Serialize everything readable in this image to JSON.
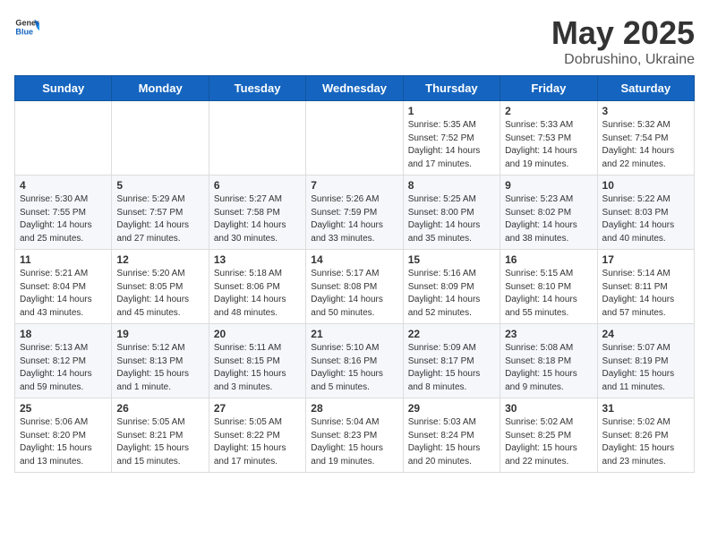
{
  "header": {
    "logo_general": "General",
    "logo_blue": "Blue",
    "month": "May 2025",
    "location": "Dobrushino, Ukraine"
  },
  "weekdays": [
    "Sunday",
    "Monday",
    "Tuesday",
    "Wednesday",
    "Thursday",
    "Friday",
    "Saturday"
  ],
  "weeks": [
    [
      {
        "day": "",
        "info": ""
      },
      {
        "day": "",
        "info": ""
      },
      {
        "day": "",
        "info": ""
      },
      {
        "day": "",
        "info": ""
      },
      {
        "day": "1",
        "info": "Sunrise: 5:35 AM\nSunset: 7:52 PM\nDaylight: 14 hours\nand 17 minutes."
      },
      {
        "day": "2",
        "info": "Sunrise: 5:33 AM\nSunset: 7:53 PM\nDaylight: 14 hours\nand 19 minutes."
      },
      {
        "day": "3",
        "info": "Sunrise: 5:32 AM\nSunset: 7:54 PM\nDaylight: 14 hours\nand 22 minutes."
      }
    ],
    [
      {
        "day": "4",
        "info": "Sunrise: 5:30 AM\nSunset: 7:55 PM\nDaylight: 14 hours\nand 25 minutes."
      },
      {
        "day": "5",
        "info": "Sunrise: 5:29 AM\nSunset: 7:57 PM\nDaylight: 14 hours\nand 27 minutes."
      },
      {
        "day": "6",
        "info": "Sunrise: 5:27 AM\nSunset: 7:58 PM\nDaylight: 14 hours\nand 30 minutes."
      },
      {
        "day": "7",
        "info": "Sunrise: 5:26 AM\nSunset: 7:59 PM\nDaylight: 14 hours\nand 33 minutes."
      },
      {
        "day": "8",
        "info": "Sunrise: 5:25 AM\nSunset: 8:00 PM\nDaylight: 14 hours\nand 35 minutes."
      },
      {
        "day": "9",
        "info": "Sunrise: 5:23 AM\nSunset: 8:02 PM\nDaylight: 14 hours\nand 38 minutes."
      },
      {
        "day": "10",
        "info": "Sunrise: 5:22 AM\nSunset: 8:03 PM\nDaylight: 14 hours\nand 40 minutes."
      }
    ],
    [
      {
        "day": "11",
        "info": "Sunrise: 5:21 AM\nSunset: 8:04 PM\nDaylight: 14 hours\nand 43 minutes."
      },
      {
        "day": "12",
        "info": "Sunrise: 5:20 AM\nSunset: 8:05 PM\nDaylight: 14 hours\nand 45 minutes."
      },
      {
        "day": "13",
        "info": "Sunrise: 5:18 AM\nSunset: 8:06 PM\nDaylight: 14 hours\nand 48 minutes."
      },
      {
        "day": "14",
        "info": "Sunrise: 5:17 AM\nSunset: 8:08 PM\nDaylight: 14 hours\nand 50 minutes."
      },
      {
        "day": "15",
        "info": "Sunrise: 5:16 AM\nSunset: 8:09 PM\nDaylight: 14 hours\nand 52 minutes."
      },
      {
        "day": "16",
        "info": "Sunrise: 5:15 AM\nSunset: 8:10 PM\nDaylight: 14 hours\nand 55 minutes."
      },
      {
        "day": "17",
        "info": "Sunrise: 5:14 AM\nSunset: 8:11 PM\nDaylight: 14 hours\nand 57 minutes."
      }
    ],
    [
      {
        "day": "18",
        "info": "Sunrise: 5:13 AM\nSunset: 8:12 PM\nDaylight: 14 hours\nand 59 minutes."
      },
      {
        "day": "19",
        "info": "Sunrise: 5:12 AM\nSunset: 8:13 PM\nDaylight: 15 hours\nand 1 minute."
      },
      {
        "day": "20",
        "info": "Sunrise: 5:11 AM\nSunset: 8:15 PM\nDaylight: 15 hours\nand 3 minutes."
      },
      {
        "day": "21",
        "info": "Sunrise: 5:10 AM\nSunset: 8:16 PM\nDaylight: 15 hours\nand 5 minutes."
      },
      {
        "day": "22",
        "info": "Sunrise: 5:09 AM\nSunset: 8:17 PM\nDaylight: 15 hours\nand 8 minutes."
      },
      {
        "day": "23",
        "info": "Sunrise: 5:08 AM\nSunset: 8:18 PM\nDaylight: 15 hours\nand 9 minutes."
      },
      {
        "day": "24",
        "info": "Sunrise: 5:07 AM\nSunset: 8:19 PM\nDaylight: 15 hours\nand 11 minutes."
      }
    ],
    [
      {
        "day": "25",
        "info": "Sunrise: 5:06 AM\nSunset: 8:20 PM\nDaylight: 15 hours\nand 13 minutes."
      },
      {
        "day": "26",
        "info": "Sunrise: 5:05 AM\nSunset: 8:21 PM\nDaylight: 15 hours\nand 15 minutes."
      },
      {
        "day": "27",
        "info": "Sunrise: 5:05 AM\nSunset: 8:22 PM\nDaylight: 15 hours\nand 17 minutes."
      },
      {
        "day": "28",
        "info": "Sunrise: 5:04 AM\nSunset: 8:23 PM\nDaylight: 15 hours\nand 19 minutes."
      },
      {
        "day": "29",
        "info": "Sunrise: 5:03 AM\nSunset: 8:24 PM\nDaylight: 15 hours\nand 20 minutes."
      },
      {
        "day": "30",
        "info": "Sunrise: 5:02 AM\nSunset: 8:25 PM\nDaylight: 15 hours\nand 22 minutes."
      },
      {
        "day": "31",
        "info": "Sunrise: 5:02 AM\nSunset: 8:26 PM\nDaylight: 15 hours\nand 23 minutes."
      }
    ]
  ]
}
